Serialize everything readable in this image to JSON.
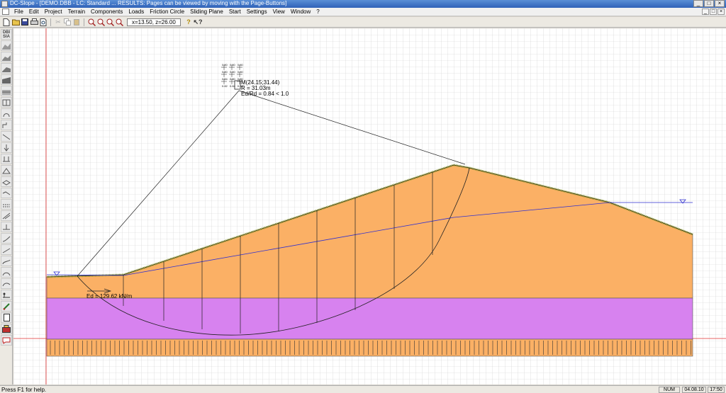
{
  "window": {
    "title": "DC-Slope - [DEMO.DBB -  LC: Standard ... RESULTS: Pages can be viewed by moving with the Page-Buttons]",
    "controls": [
      "_",
      "□",
      "×"
    ]
  },
  "menu": {
    "items": [
      "File",
      "Edit",
      "Project",
      "Terrain",
      "Components",
      "Loads",
      "Friction Circle",
      "Sliding Plane",
      "Start",
      "Settings",
      "View",
      "Window",
      "?"
    ],
    "mdi_controls": [
      "_",
      "□",
      "×"
    ]
  },
  "toolbar": {
    "coord_readout": "x=13.50, z=26.00"
  },
  "lefttools": {
    "dbi_label_top": "DBI",
    "dbi_label_bottom": "SIA"
  },
  "drawing": {
    "center_label": "M(24.15;31.44)",
    "radius_label": "R = 31.03m",
    "ratio_label": "Ed/Rd = 0.84 < 1.0",
    "force_label": "Ed = 129.62 kN/m",
    "grid_values": [
      "0.80",
      "0.80",
      "0.80",
      "0.80",
      "0.80",
      "0.80",
      "0.84",
      "0.80",
      "0.80",
      "0.82",
      "0.84",
      "0.84"
    ],
    "colors": {
      "soil_upper": "#fbb065",
      "soil_middle": "#d782ef",
      "grass": "#8a9a2a",
      "water_line": "#3030d0",
      "reference_line": "#e03030"
    }
  },
  "status": {
    "help": "Press F1 for help.",
    "num": "NUM",
    "date": "04.08.10",
    "time": "17:50"
  }
}
